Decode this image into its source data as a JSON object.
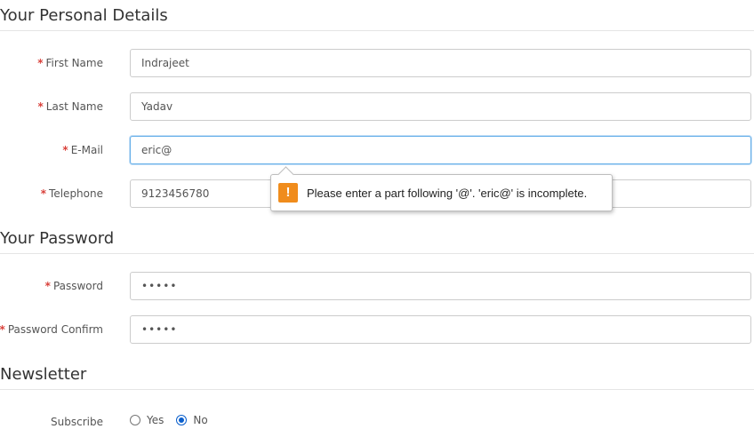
{
  "personal": {
    "title": "Your Personal Details",
    "first_name": {
      "label": "First Name",
      "value": "Indrajeet"
    },
    "last_name": {
      "label": "Last Name",
      "value": "Yadav"
    },
    "email": {
      "label": "E-Mail",
      "value": "eric@"
    },
    "telephone": {
      "label": "Telephone",
      "value": "9123456780"
    }
  },
  "required_marker": "*",
  "tooltip": {
    "icon": "!",
    "message": "Please enter a part following '@'. 'eric@' is incomplete."
  },
  "password_section": {
    "title": "Your Password",
    "password": {
      "label": "Password",
      "value": "•••••"
    },
    "confirm": {
      "label": "Password Confirm",
      "value": "•••••"
    }
  },
  "newsletter": {
    "title": "Newsletter",
    "subscribe_label": "Subscribe",
    "options": [
      {
        "label": "Yes",
        "checked": false
      },
      {
        "label": "No",
        "checked": true
      }
    ]
  },
  "colors": {
    "required": "#d9403a",
    "focus_border": "#66afe9",
    "warning": "#f08c1c",
    "radio_checked": "#0b5fcc"
  }
}
